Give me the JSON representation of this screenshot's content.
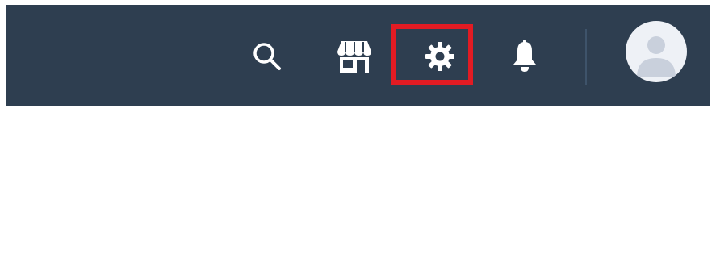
{
  "header": {
    "background_color": "#2e3e50",
    "icon_color": "#ffffff",
    "highlight_color": "#e21b23",
    "actions": [
      {
        "id": "search",
        "icon": "search-icon"
      },
      {
        "id": "store",
        "icon": "store-icon"
      },
      {
        "id": "settings",
        "icon": "gear-icon",
        "highlighted": true
      },
      {
        "id": "notifications",
        "icon": "bell-icon"
      }
    ],
    "user": {
      "avatar": "user-avatar-placeholder"
    }
  }
}
